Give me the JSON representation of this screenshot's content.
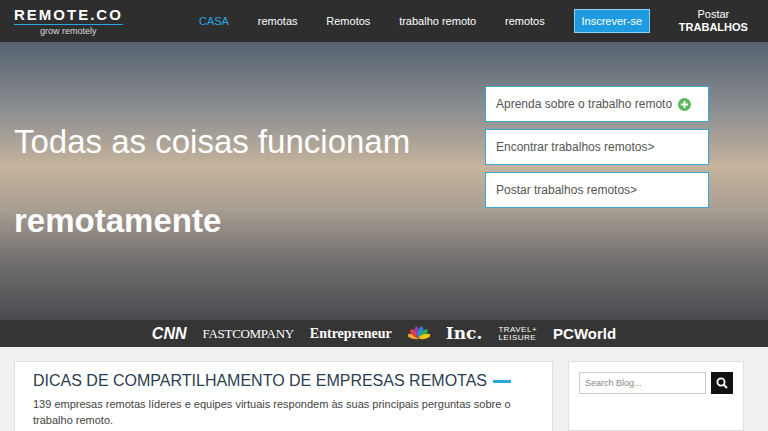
{
  "header": {
    "logo": {
      "name": "REMOTE.CO",
      "tagline": "grow remotely"
    },
    "nav": [
      {
        "label": "CASA",
        "selected": true
      },
      {
        "label": "remotas",
        "selected": false
      },
      {
        "label": "Remotos",
        "selected": false
      },
      {
        "label": "trabalho remoto",
        "selected": false
      },
      {
        "label": "remotos",
        "selected": false
      }
    ],
    "signup_button": "Inscrever-se",
    "post_jobs": {
      "line1": "Postar",
      "line2": "TRABALHOS"
    }
  },
  "hero": {
    "headline_line1": "Todas as coisas funcionam",
    "headline_line2": "remotamente",
    "actions": [
      {
        "label": "Aprenda sobre o trabalho remoto",
        "kind": "expand"
      },
      {
        "label": "Encontrar trabalhos remotos>",
        "kind": "link"
      },
      {
        "label": "Postar trabalhos remotos>",
        "kind": "link"
      }
    ]
  },
  "press": [
    {
      "lines": [
        "CNN"
      ],
      "kind": "heavy"
    },
    {
      "lines": [
        "FASTCOMPANY"
      ],
      "kind": "condensed"
    },
    {
      "lines": [
        "Entrepreneur"
      ],
      "kind": "serif"
    },
    {
      "lines": [],
      "kind": "peacock"
    },
    {
      "lines": [
        "Inc."
      ],
      "kind": "slab"
    },
    {
      "lines": [
        "TRAVEL+",
        "LEISURE"
      ],
      "kind": "stacked"
    },
    {
      "lines": [
        "PCWorld"
      ],
      "kind": "bold"
    }
  ],
  "blog": {
    "title": "DICAS DE COMPARTILHAMENTO DE EMPRESAS REMOTAS",
    "subtitle": "139 empresas remotas líderes e equipes virtuais respondem às suas principais perguntas sobre o trabalho remoto."
  },
  "sidebar": {
    "search": {
      "placeholder": "Search Blog..."
    }
  }
}
